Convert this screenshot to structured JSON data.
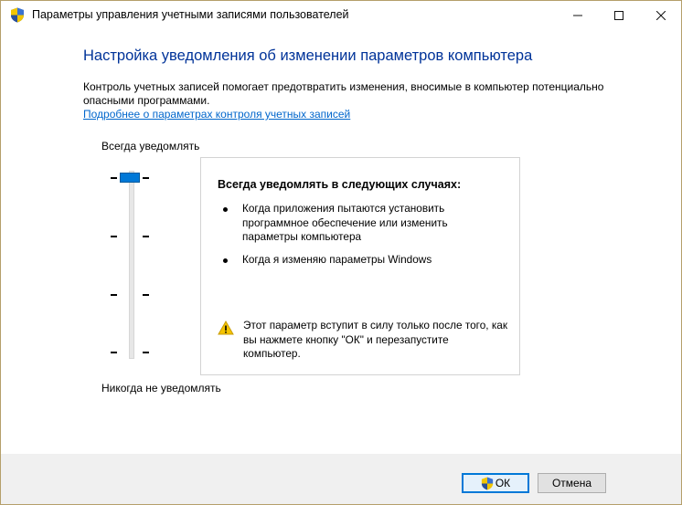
{
  "window": {
    "title": "Параметры управления учетными записями пользователей",
    "controls": {
      "minimize": "─",
      "maximize": "☐",
      "close": "✕"
    }
  },
  "main": {
    "heading": "Настройка уведомления об изменении параметров компьютера",
    "description": "Контроль учетных записей помогает предотвратить изменения, вносимые в компьютер потенциально опасными программами.",
    "link": "Подробнее о параметрах контроля учетных записей"
  },
  "slider": {
    "label_top": "Всегда уведомлять",
    "label_bottom": "Никогда не уведомлять",
    "levels": 4,
    "selected_level": 4
  },
  "info": {
    "title": "Всегда уведомлять в следующих случаях:",
    "bullets": [
      "Когда приложения пытаются установить программное обеспечение или изменить параметры компьютера",
      "Когда я изменяю параметры Windows"
    ],
    "warning": "Этот параметр вступит в силу только после того, как вы нажмете кнопку \"ОК\" и перезапустите компьютер.",
    "warning_icon": "warning-icon"
  },
  "buttons": {
    "ok": "ОК",
    "cancel": "Отмена"
  },
  "icons": {
    "title_icon": "uac-shield-icon",
    "ok_icon": "uac-shield-icon"
  },
  "colors": {
    "heading": "#003399",
    "link": "#0066cc",
    "accent": "#0078d7",
    "window_border": "#b59f6a"
  }
}
